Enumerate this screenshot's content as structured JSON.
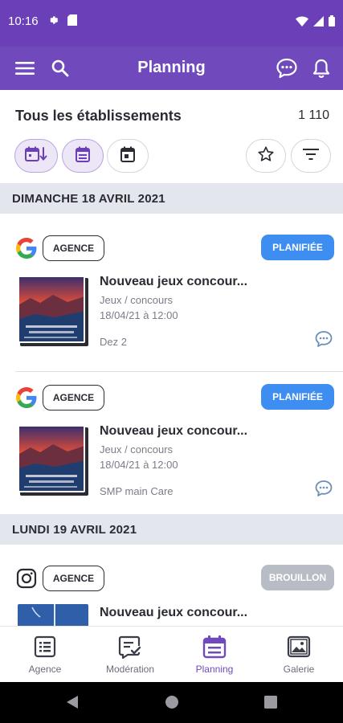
{
  "status_bar": {
    "time": "10:16"
  },
  "app_bar": {
    "title": "Planning",
    "icons": [
      "menu-icon",
      "search-icon",
      "chat-icon",
      "bell-icon"
    ]
  },
  "filter": {
    "establishments_label": "Tous les établissements",
    "count": "1 110",
    "chips": [
      "calendar-sort-icon",
      "calendar-list-icon",
      "calendar-day-icon",
      "star-icon",
      "filter-icon"
    ]
  },
  "feed": {
    "groups": [
      {
        "date": "DIMANCHE 18 AVRIL 2021",
        "posts": [
          {
            "platform": "google",
            "agency": "AGENCE",
            "status": "PLANIFIÉE",
            "title": "Nouveau jeux concour...",
            "category": "Jeux / concours",
            "datetime": "18/04/21 à 12:00",
            "author": "Dez 2"
          },
          {
            "platform": "google",
            "agency": "AGENCE",
            "status": "PLANIFIÉE",
            "title": "Nouveau jeux concour...",
            "category": "Jeux / concours",
            "datetime": "18/04/21 à 12:00",
            "author": "SMP main Care"
          }
        ]
      },
      {
        "date": "LUNDI 19 AVRIL 2021",
        "posts": [
          {
            "platform": "instagram",
            "agency": "AGENCE",
            "status": "BROUILLON",
            "title": "Nouveau jeux concour..."
          }
        ]
      }
    ]
  },
  "bottom_nav": {
    "items": [
      {
        "label": "Agence",
        "icon": "list-icon"
      },
      {
        "label": "Modération",
        "icon": "moderation-icon"
      },
      {
        "label": "Planning",
        "icon": "calendar-icon",
        "active": true
      },
      {
        "label": "Galerie",
        "icon": "image-icon"
      }
    ]
  },
  "colors": {
    "primary": "#7049bd",
    "status_bar": "#6a3fb8",
    "planned": "#3d8ef0",
    "draft": "#b8bcc4",
    "date_header_bg": "#e3e6ec"
  }
}
